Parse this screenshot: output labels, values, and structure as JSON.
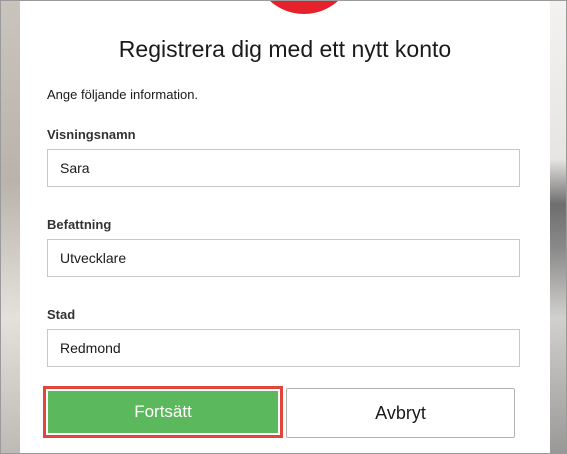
{
  "form": {
    "title": "Registrera dig med ett nytt konto",
    "instructions": "Ange följande information.",
    "fields": [
      {
        "label": "Visningsnamn",
        "value": "Sara"
      },
      {
        "label": "Befattning",
        "value": "Utvecklare"
      },
      {
        "label": "Stad",
        "value": "Redmond"
      }
    ]
  },
  "actions": {
    "continue_label": "Fortsätt",
    "cancel_label": "Avbryt"
  },
  "colors": {
    "brand_logo": "#e5212b",
    "primary_button": "#5cb85c",
    "highlight_outline": "#e2463a"
  }
}
